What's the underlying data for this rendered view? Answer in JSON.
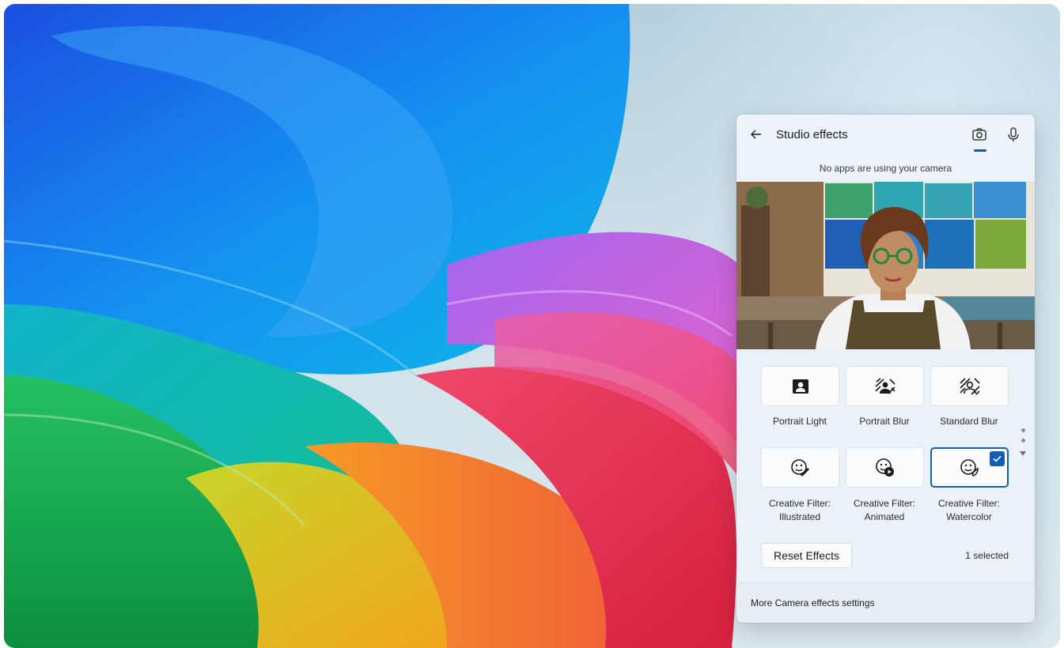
{
  "panel": {
    "title": "Studio effects",
    "status": "No apps are using your camera",
    "tabs": [
      {
        "name": "camera",
        "icon": "camera-icon",
        "selected": true
      },
      {
        "name": "microphone",
        "icon": "microphone-icon",
        "selected": false
      }
    ]
  },
  "effects": [
    {
      "label": "Portrait Light",
      "icon": "portrait-light-icon",
      "selected": false
    },
    {
      "label": "Portrait Blur",
      "icon": "portrait-blur-icon",
      "selected": false
    },
    {
      "label": "Standard Blur",
      "icon": "standard-blur-icon",
      "selected": false
    },
    {
      "label": "Creative Filter:\nIllustrated",
      "icon": "creative-illustrated-icon",
      "selected": false
    },
    {
      "label": "Creative Filter:\nAnimated",
      "icon": "creative-animated-icon",
      "selected": false
    },
    {
      "label": "Creative Filter:\nWatercolor",
      "icon": "creative-watercolor-icon",
      "selected": true
    }
  ],
  "reset_label": "Reset Effects",
  "selected_count": "1 selected",
  "footer_link": "More Camera effects settings",
  "colors": {
    "accent": "#005fb8",
    "panel_bg": "#eaf2f8"
  }
}
